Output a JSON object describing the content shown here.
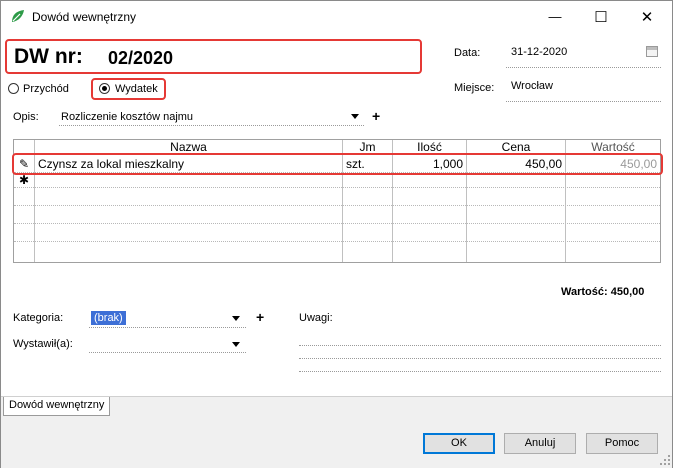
{
  "window": {
    "title": "Dowód wewnętrzny",
    "minimize_glyph": "—",
    "maximize_glyph": "☐",
    "close_glyph": "✕"
  },
  "header": {
    "dw_label": "DW nr:",
    "dw_number": "02/2020",
    "date_label": "Data:",
    "date_value": "31-12-2020",
    "place_label": "Miejsce:",
    "place_value": "Wrocław"
  },
  "type": {
    "income_label": "Przychód",
    "expense_label": "Wydatek",
    "selected": "Wydatek"
  },
  "description": {
    "label": "Opis:",
    "value": "Rozliczenie kosztów najmu",
    "add_glyph": "+"
  },
  "table": {
    "columns": [
      "Nazwa",
      "Jm",
      "Ilość",
      "Cena",
      "Wartość"
    ],
    "rows": [
      {
        "marker": "✎",
        "name": "Czynsz za lokal mieszkalny",
        "unit": "szt.",
        "qty": "1,000",
        "price": "450,00",
        "value": "450,00"
      }
    ],
    "new_row_marker": "✱"
  },
  "total": {
    "text": "Wartość: 450,00"
  },
  "category": {
    "label": "Kategoria:",
    "value": "(brak)",
    "add_glyph": "+"
  },
  "issuer": {
    "label": "Wystawił(a):",
    "value": ""
  },
  "notes": {
    "label": "Uwagi:"
  },
  "tabs": {
    "active": "Dowód wewnętrzny"
  },
  "buttons": {
    "ok": "OK",
    "cancel": "Anuluj",
    "help": "Pomoc"
  },
  "colors": {
    "highlight_red": "#e53935",
    "selection_blue": "#3d6fd6"
  }
}
